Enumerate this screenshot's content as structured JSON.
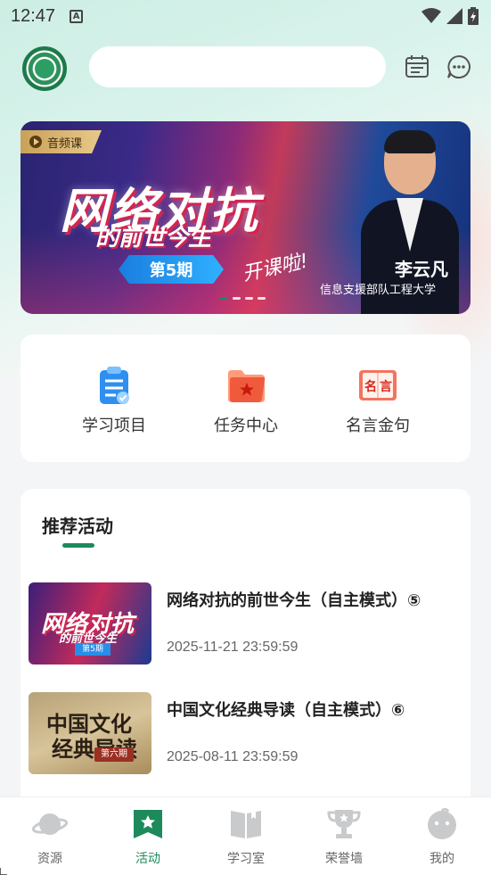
{
  "status_bar": {
    "time": "12:47",
    "notification_icon": "A"
  },
  "header": {
    "logo": "organization-logo",
    "search_placeholder": "",
    "icons": [
      "calendar-icon",
      "message-icon"
    ]
  },
  "banner": {
    "tag": "音频课",
    "title": "网络对抗",
    "subtitle": "的前世今生",
    "issue": "第5期",
    "signature": "开课啦!",
    "speaker_name": "李云凡",
    "speaker_org": "信息支援部队工程大学",
    "slide_count": 4,
    "active_slide": 1
  },
  "quick_menu": [
    {
      "label": "学习项目",
      "icon": "clipboard-icon",
      "color": "#2f8ff0"
    },
    {
      "label": "任务中心",
      "icon": "star-folder-icon",
      "color": "#f05a3c"
    },
    {
      "label": "名言金句",
      "icon": "quote-book-icon",
      "color": "#e24a3a"
    }
  ],
  "recommended": {
    "title": "推荐活动",
    "items": [
      {
        "title": "网络对抗的前世今生（自主模式）⑤",
        "time": "2025-11-21 23:59:59",
        "thumb_line1": "网络对抗",
        "thumb_line2": "的前世今生",
        "thumb_badge": "第5期"
      },
      {
        "title": "中国文化经典导读（自主模式）⑥",
        "time": "2025-08-11 23:59:59",
        "thumb_line1": "中国文化",
        "thumb_line2": "经典导读",
        "thumb_badge": "第六期"
      }
    ]
  },
  "tabbar": {
    "tabs": [
      {
        "label": "资源",
        "icon": "planet-icon",
        "active": false
      },
      {
        "label": "活动",
        "icon": "star-bookmark-icon",
        "active": true
      },
      {
        "label": "学习室",
        "icon": "book-icon",
        "active": false
      },
      {
        "label": "荣誉墙",
        "icon": "trophy-icon",
        "active": false
      },
      {
        "label": "我的",
        "icon": "profile-face-icon",
        "active": false
      }
    ],
    "active_color": "#1d8a5b",
    "inactive_color": "#c8cacc"
  }
}
